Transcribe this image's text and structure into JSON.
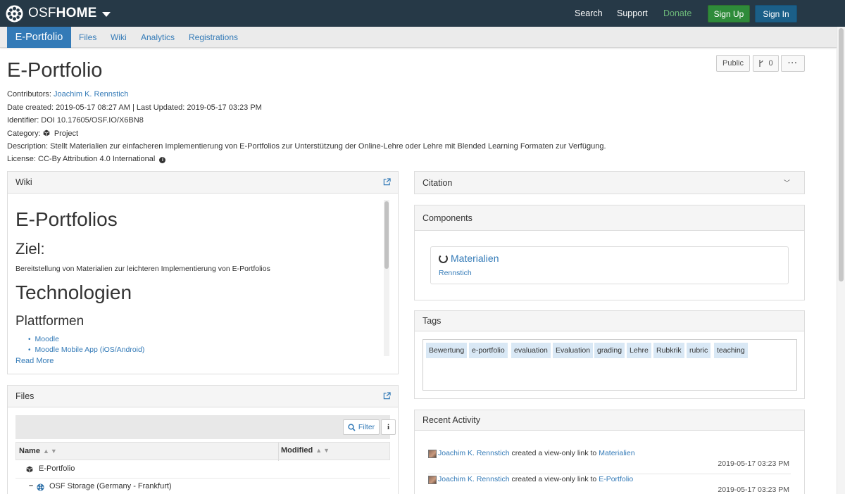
{
  "navbar": {
    "brand_osf": "OSF",
    "brand_home": "HOME",
    "search": "Search",
    "support": "Support",
    "donate": "Donate",
    "sign_up": "Sign Up",
    "sign_in": "Sign In"
  },
  "project_nav": {
    "active": "E-Portfolio",
    "items": [
      "Files",
      "Wiki",
      "Analytics",
      "Registrations"
    ]
  },
  "header": {
    "title": "E-Portfolio",
    "public_label": "Public",
    "fork_count": "0",
    "more_label": "···"
  },
  "meta": {
    "contributors_label": "Contributors:",
    "contributor": "Joachim K. Rennstich",
    "dates": "Date created: 2019-05-17 08:27 AM | Last Updated: 2019-05-17 03:23 PM",
    "identifier": "Identifier: DOI 10.17605/OSF.IO/X6BN8",
    "category_label": "Category:",
    "category": "Project",
    "description": "Description: Stellt Materialien zur einfacheren Implementierung von E-Portfolios zur Unterstützung der Online-Lehre oder Lehre mit Blended Learning Formaten zur Verfügung.",
    "license_label": "License:",
    "license": "CC-By Attribution 4.0 International"
  },
  "wiki": {
    "heading": "Wiki",
    "h1": "E-Portfolios",
    "h2": "Ziel:",
    "paragraph": "Bereitstellung von Materialien zur leichteren Implementierung von E-Portfolios",
    "h1b": "Technologien",
    "h3": "Plattformen",
    "list": [
      "Moodle",
      "Moodle Mobile App (iOS/Android)"
    ],
    "read_more": "Read More"
  },
  "files": {
    "heading": "Files",
    "filter_label": "Filter",
    "info_label": "i",
    "col_name": "Name",
    "col_modified": "Modified",
    "rows": [
      "E-Portfolio",
      "OSF Storage (Germany - Frankfurt)"
    ],
    "collapse_symbol": "–"
  },
  "citation": {
    "heading": "Citation"
  },
  "components": {
    "heading": "Components",
    "title": "Materialien",
    "user": "Rennstich"
  },
  "tags": {
    "heading": "Tags",
    "items": [
      "Bewertung",
      "e-portfolio",
      "evaluation",
      "Evaluation",
      "grading",
      "Lehre",
      "Rubkrik",
      "rubric",
      "teaching"
    ]
  },
  "recent_activity": {
    "heading": "Recent Activity",
    "items": [
      {
        "user": "Joachim K. Rennstich",
        "action": " created a view-only link to ",
        "target": "Materialien",
        "date": "2019-05-17 03:23 PM"
      },
      {
        "user": "Joachim K. Rennstich",
        "action": " created a view-only link to ",
        "target": "E-Portfolio",
        "date": "2019-05-17 03:23 PM"
      }
    ]
  },
  "colors": {
    "navbar": "#263947",
    "link": "#337ab7",
    "donate": "#6cb779",
    "sign_up": "#2e8b3a",
    "sign_in": "#1b5f88",
    "tag_bg": "#d9e8f5"
  }
}
